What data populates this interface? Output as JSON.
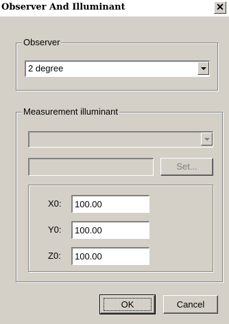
{
  "window": {
    "title": "Observer And Illuminant",
    "close_glyph": "✕"
  },
  "observer": {
    "group_label": "Observer",
    "selected": "2 degree"
  },
  "illuminant": {
    "group_label": "Measurement illuminant",
    "selected": "",
    "name_value": "",
    "set_label": "Set...",
    "white_point": {
      "x0_label": "X0:",
      "x0_value": "100.00",
      "y0_label": "Y0:",
      "y0_value": "100.00",
      "z0_label": "Z0:",
      "z0_value": "100.00"
    }
  },
  "buttons": {
    "ok_label": "OK",
    "cancel_label": "Cancel"
  }
}
